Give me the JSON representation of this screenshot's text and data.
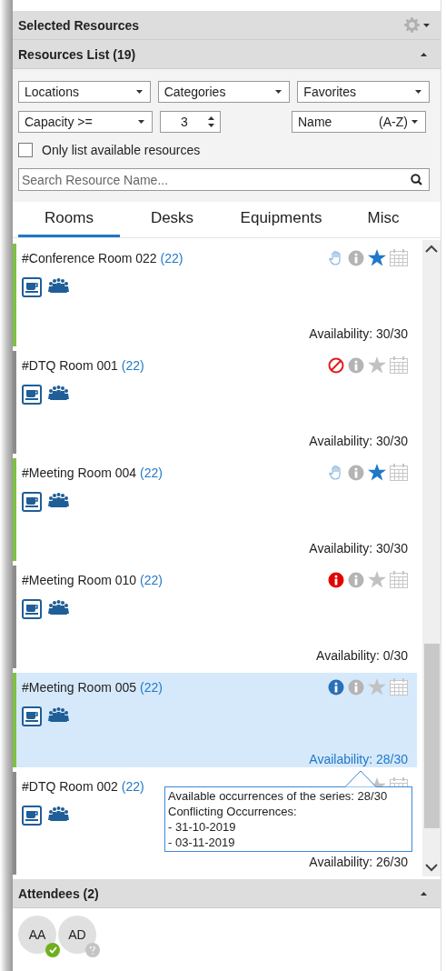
{
  "header": {
    "title": "Selected Resources"
  },
  "resources_list": {
    "title": "Resources List (19)",
    "expanded": true
  },
  "filters": {
    "dropdowns": [
      {
        "label": "Locations"
      },
      {
        "label": "Categories"
      },
      {
        "label": "Favorites"
      }
    ],
    "capacity": {
      "label": "Capacity >=",
      "value": "3"
    },
    "sort": {
      "label": "Name",
      "order": "(A-Z)"
    },
    "only_available": {
      "label": "Only list available resources",
      "checked": false
    },
    "search": {
      "placeholder": "Search Resource Name..."
    }
  },
  "tabs": [
    {
      "label": "Rooms",
      "selected": true
    },
    {
      "label": "Desks",
      "selected": false
    },
    {
      "label": "Equipments",
      "selected": false
    },
    {
      "label": "Misc",
      "selected": false
    }
  ],
  "rooms": [
    {
      "name": "#Conference Room 022",
      "count": "(22)",
      "color": "#7dc242",
      "kind": "hand",
      "favorite": true,
      "selected": false,
      "availability": "Availability: 30/30"
    },
    {
      "name": "#DTQ Room 001",
      "count": "(22)",
      "color": "#8c8c8c",
      "kind": "blocked",
      "favorite": false,
      "selected": false,
      "availability": "Availability: 30/30"
    },
    {
      "name": "#Meeting Room 004",
      "count": "(22)",
      "color": "#7dc242",
      "kind": "hand",
      "favorite": true,
      "selected": false,
      "availability": "Availability: 30/30"
    },
    {
      "name": "#Meeting Room 010",
      "count": "(22)",
      "color": "#8c8c8c",
      "kind": "conflict",
      "favorite": false,
      "selected": false,
      "availability": "Availability: 0/30"
    },
    {
      "name": "#Meeting Room 005",
      "count": "(22)",
      "color": "#7dc242",
      "kind": "partial",
      "favorite": false,
      "selected": true,
      "availability": "Availability: 28/30",
      "tooltip": [
        "Available occurrences of the series: 28/30",
        "Conflicting Occurrences:",
        "- 31-10-2019",
        "- 03-11-2019"
      ]
    },
    {
      "name": "#DTQ Room 002",
      "count": "(22)",
      "color": "#8c8c8c",
      "favorite": false,
      "selected": false,
      "availability": "Availability: 26/30"
    }
  ],
  "attendees": {
    "title": "Attendees (2)",
    "expanded": true,
    "people": [
      {
        "initials": "AA",
        "kind": "accepted"
      },
      {
        "initials": "AD",
        "kind": "unknown"
      }
    ]
  }
}
